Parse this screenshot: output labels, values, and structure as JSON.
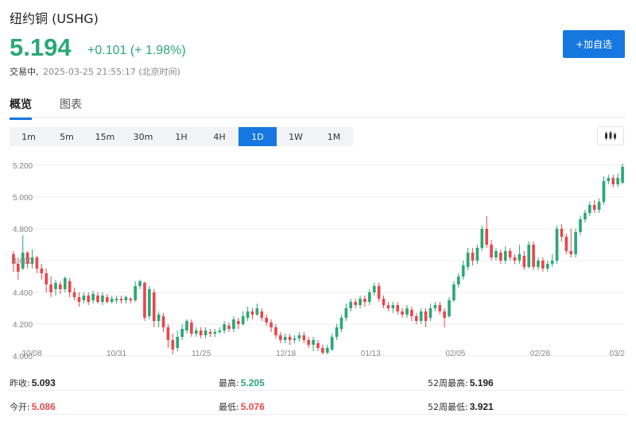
{
  "header": {
    "title": "纽约铜 (USHG)",
    "price": "5.194",
    "change": "+0.101 (+ 1.98%)",
    "status_label": "交易中,",
    "timestamp": "2025-03-25 21:55:17 (北京时间)",
    "add_button": "+加自选"
  },
  "tabs": [
    {
      "label": "概览",
      "active": true
    },
    {
      "label": "图表",
      "active": false
    }
  ],
  "ranges": [
    "1m",
    "5m",
    "15m",
    "30m",
    "1H",
    "4H",
    "1D",
    "1W",
    "1M"
  ],
  "active_range": "1D",
  "colors": {
    "up": "#2aa876",
    "down": "#e8474d",
    "accent": "#1677e0"
  },
  "chart_data": {
    "type": "candlestick",
    "y_ticks": [
      "5.200",
      "5.000",
      "4.800",
      "4.600",
      "4.400",
      "4.200",
      "4.000"
    ],
    "ylim": [
      4.0,
      5.2
    ],
    "x_labels": [
      "10/08",
      "10/31",
      "11/25",
      "12/18",
      "01/13",
      "02/05",
      "02/28",
      "03/2"
    ],
    "candles": [
      [
        4.64,
        4.58,
        4.66,
        4.53
      ],
      [
        4.58,
        4.53,
        4.62,
        4.48
      ],
      [
        4.55,
        4.65,
        4.76,
        4.54
      ],
      [
        4.65,
        4.58,
        4.66,
        4.55
      ],
      [
        4.58,
        4.62,
        4.67,
        4.55
      ],
      [
        4.62,
        4.55,
        4.63,
        4.52
      ],
      [
        4.55,
        4.52,
        4.58,
        4.48
      ],
      [
        4.52,
        4.45,
        4.55,
        4.4
      ],
      [
        4.45,
        4.4,
        4.5,
        4.37
      ],
      [
        4.42,
        4.46,
        4.48,
        4.38
      ],
      [
        4.45,
        4.42,
        4.47,
        4.39
      ],
      [
        4.42,
        4.49,
        4.5,
        4.4
      ],
      [
        4.47,
        4.4,
        4.49,
        4.37
      ],
      [
        4.4,
        4.37,
        4.43,
        4.35
      ],
      [
        4.37,
        4.34,
        4.4,
        4.31
      ],
      [
        4.35,
        4.38,
        4.4,
        4.33
      ],
      [
        4.38,
        4.34,
        4.4,
        4.32
      ],
      [
        4.35,
        4.39,
        4.41,
        4.33
      ],
      [
        4.38,
        4.34,
        4.4,
        4.33
      ],
      [
        4.34,
        4.38,
        4.4,
        4.32
      ],
      [
        4.37,
        4.34,
        4.39,
        4.33
      ],
      [
        4.34,
        4.36,
        4.38,
        4.33
      ],
      [
        4.35,
        4.36,
        4.38,
        4.33
      ],
      [
        4.36,
        4.35,
        4.38,
        4.33
      ],
      [
        4.35,
        4.37,
        4.38,
        4.33
      ],
      [
        4.36,
        4.35,
        4.37,
        4.33
      ],
      [
        4.35,
        4.44,
        4.47,
        4.34
      ],
      [
        4.44,
        4.47,
        4.48,
        4.42
      ],
      [
        4.46,
        4.24,
        4.47,
        4.22
      ],
      [
        4.25,
        4.42,
        4.44,
        4.23
      ],
      [
        4.4,
        4.22,
        4.42,
        4.18
      ],
      [
        4.22,
        4.26,
        4.28,
        4.18
      ],
      [
        4.25,
        4.18,
        4.27,
        4.15
      ],
      [
        4.18,
        4.1,
        4.2,
        4.05
      ],
      [
        4.1,
        4.04,
        4.14,
        4.01
      ],
      [
        4.05,
        4.12,
        4.16,
        4.03
      ],
      [
        4.12,
        4.17,
        4.2,
        4.1
      ],
      [
        4.16,
        4.22,
        4.23,
        4.14
      ],
      [
        4.21,
        4.14,
        4.23,
        4.12
      ],
      [
        4.14,
        4.16,
        4.18,
        4.12
      ],
      [
        4.16,
        4.13,
        4.18,
        4.11
      ],
      [
        4.13,
        4.16,
        4.18,
        4.11
      ],
      [
        4.15,
        4.14,
        4.17,
        4.12
      ],
      [
        4.14,
        4.15,
        4.17,
        4.12
      ],
      [
        4.15,
        4.16,
        4.18,
        4.14
      ],
      [
        4.16,
        4.2,
        4.22,
        4.14
      ],
      [
        4.19,
        4.17,
        4.21,
        4.15
      ],
      [
        4.17,
        4.23,
        4.25,
        4.15
      ],
      [
        4.22,
        4.2,
        4.24,
        4.17
      ],
      [
        4.2,
        4.25,
        4.28,
        4.19
      ],
      [
        4.24,
        4.28,
        4.31,
        4.22
      ],
      [
        4.28,
        4.26,
        4.3,
        4.23
      ],
      [
        4.26,
        4.3,
        4.33,
        4.25
      ],
      [
        4.28,
        4.24,
        4.3,
        4.22
      ],
      [
        4.24,
        4.21,
        4.26,
        4.19
      ],
      [
        4.21,
        4.18,
        4.23,
        4.15
      ],
      [
        4.18,
        4.13,
        4.2,
        4.11
      ],
      [
        4.13,
        4.1,
        4.15,
        4.08
      ],
      [
        4.1,
        4.12,
        4.14,
        4.08
      ],
      [
        4.12,
        4.1,
        4.14,
        4.07
      ],
      [
        4.1,
        4.11,
        4.13,
        4.08
      ],
      [
        4.11,
        4.13,
        4.15,
        4.09
      ],
      [
        4.13,
        4.1,
        4.15,
        4.08
      ],
      [
        4.1,
        4.07,
        4.12,
        4.05
      ],
      [
        4.07,
        4.1,
        4.12,
        4.03
      ],
      [
        4.08,
        4.05,
        4.1,
        4.03
      ],
      [
        4.05,
        4.02,
        4.07,
        4.01
      ],
      [
        4.02,
        4.05,
        4.07,
        4.01
      ],
      [
        4.04,
        4.12,
        4.14,
        4.03
      ],
      [
        4.12,
        4.18,
        4.2,
        4.1
      ],
      [
        4.17,
        4.24,
        4.26,
        4.15
      ],
      [
        4.24,
        4.3,
        4.33,
        4.22
      ],
      [
        4.3,
        4.34,
        4.36,
        4.28
      ],
      [
        4.34,
        4.32,
        4.36,
        4.3
      ],
      [
        4.32,
        4.36,
        4.38,
        4.3
      ],
      [
        4.36,
        4.34,
        4.38,
        4.31
      ],
      [
        4.34,
        4.4,
        4.42,
        4.32
      ],
      [
        4.4,
        4.44,
        4.46,
        4.38
      ],
      [
        4.44,
        4.36,
        4.46,
        4.34
      ],
      [
        4.36,
        4.32,
        4.38,
        4.3
      ],
      [
        4.32,
        4.3,
        4.34,
        4.28
      ],
      [
        4.3,
        4.32,
        4.34,
        4.27
      ],
      [
        4.32,
        4.28,
        4.34,
        4.26
      ],
      [
        4.28,
        4.26,
        4.3,
        4.24
      ],
      [
        4.26,
        4.3,
        4.32,
        4.24
      ],
      [
        4.29,
        4.25,
        4.31,
        4.22
      ],
      [
        4.25,
        4.22,
        4.27,
        4.2
      ],
      [
        4.22,
        4.28,
        4.3,
        4.2
      ],
      [
        4.28,
        4.22,
        4.3,
        4.18
      ],
      [
        4.24,
        4.3,
        4.33,
        4.22
      ],
      [
        4.3,
        4.32,
        4.34,
        4.28
      ],
      [
        4.32,
        4.28,
        4.34,
        4.26
      ],
      [
        4.28,
        4.24,
        4.3,
        4.18
      ],
      [
        4.25,
        4.35,
        4.37,
        4.24
      ],
      [
        4.35,
        4.45,
        4.47,
        4.34
      ],
      [
        4.45,
        4.5,
        4.52,
        4.43
      ],
      [
        4.5,
        4.57,
        4.6,
        4.48
      ],
      [
        4.56,
        4.65,
        4.68,
        4.54
      ],
      [
        4.65,
        4.6,
        4.68,
        4.57
      ],
      [
        4.6,
        4.68,
        4.7,
        4.58
      ],
      [
        4.68,
        4.8,
        4.82,
        4.66
      ],
      [
        4.8,
        4.7,
        4.88,
        4.68
      ],
      [
        4.7,
        4.62,
        4.73,
        4.6
      ],
      [
        4.62,
        4.66,
        4.68,
        4.6
      ],
      [
        4.65,
        4.6,
        4.67,
        4.58
      ],
      [
        4.6,
        4.66,
        4.69,
        4.58
      ],
      [
        4.66,
        4.62,
        4.68,
        4.6
      ],
      [
        4.62,
        4.6,
        4.64,
        4.58
      ],
      [
        4.6,
        4.64,
        4.7,
        4.58
      ],
      [
        4.63,
        4.56,
        4.66,
        4.54
      ],
      [
        4.56,
        4.7,
        4.72,
        4.55
      ],
      [
        4.7,
        4.56,
        4.72,
        4.54
      ],
      [
        4.56,
        4.6,
        4.62,
        4.54
      ],
      [
        4.6,
        4.55,
        4.62,
        4.53
      ],
      [
        4.55,
        4.58,
        4.6,
        4.53
      ],
      [
        4.58,
        4.6,
        4.64,
        4.56
      ],
      [
        4.6,
        4.8,
        4.82,
        4.58
      ],
      [
        4.8,
        4.75,
        4.83,
        4.72
      ],
      [
        4.75,
        4.66,
        4.77,
        4.64
      ],
      [
        4.66,
        4.64,
        4.8,
        4.62
      ],
      [
        4.64,
        4.78,
        4.8,
        4.62
      ],
      [
        4.78,
        4.86,
        4.88,
        4.76
      ],
      [
        4.86,
        4.9,
        4.92,
        4.84
      ],
      [
        4.9,
        4.95,
        4.97,
        4.88
      ],
      [
        4.95,
        4.92,
        4.98,
        4.9
      ],
      [
        4.92,
        4.97,
        4.99,
        4.9
      ],
      [
        4.97,
        5.1,
        5.13,
        4.95
      ],
      [
        5.1,
        5.12,
        5.14,
        5.08
      ],
      [
        5.12,
        5.08,
        5.14,
        5.06
      ],
      [
        5.08,
        5.12,
        5.15,
        5.06
      ],
      [
        5.09,
        5.19,
        5.21,
        5.08
      ]
    ]
  },
  "stats": [
    [
      {
        "label": "昨收:",
        "value": "5.093",
        "tone": "neutral"
      },
      {
        "label": "最高:",
        "value": "5.205",
        "tone": "up"
      },
      {
        "label": "52周最高:",
        "value": "5.196",
        "tone": "neutral"
      }
    ],
    [
      {
        "label": "今开:",
        "value": "5.086",
        "tone": "down"
      },
      {
        "label": "最低:",
        "value": "5.076",
        "tone": "down"
      },
      {
        "label": "52周最低:",
        "value": "3.921",
        "tone": "neutral"
      }
    ]
  ]
}
